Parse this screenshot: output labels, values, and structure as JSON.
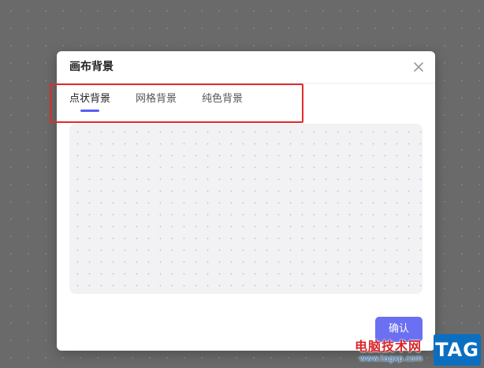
{
  "dialog": {
    "title": "画布背景",
    "tabs": [
      {
        "label": "点状背景",
        "active": true
      },
      {
        "label": "网格背景",
        "active": false
      },
      {
        "label": "纯色背景",
        "active": false
      }
    ],
    "confirm_label": "确认"
  },
  "colors": {
    "accent": "#5b5ef0",
    "confirm_bg": "#6b6ff2",
    "highlight": "#e22a2a",
    "canvas_bg": "#6a6a6a",
    "preview_bg": "#f2f2f5"
  },
  "watermark": {
    "site_name": "电脑技术网",
    "url": "www.tagxp.com",
    "tag": "TAG"
  }
}
